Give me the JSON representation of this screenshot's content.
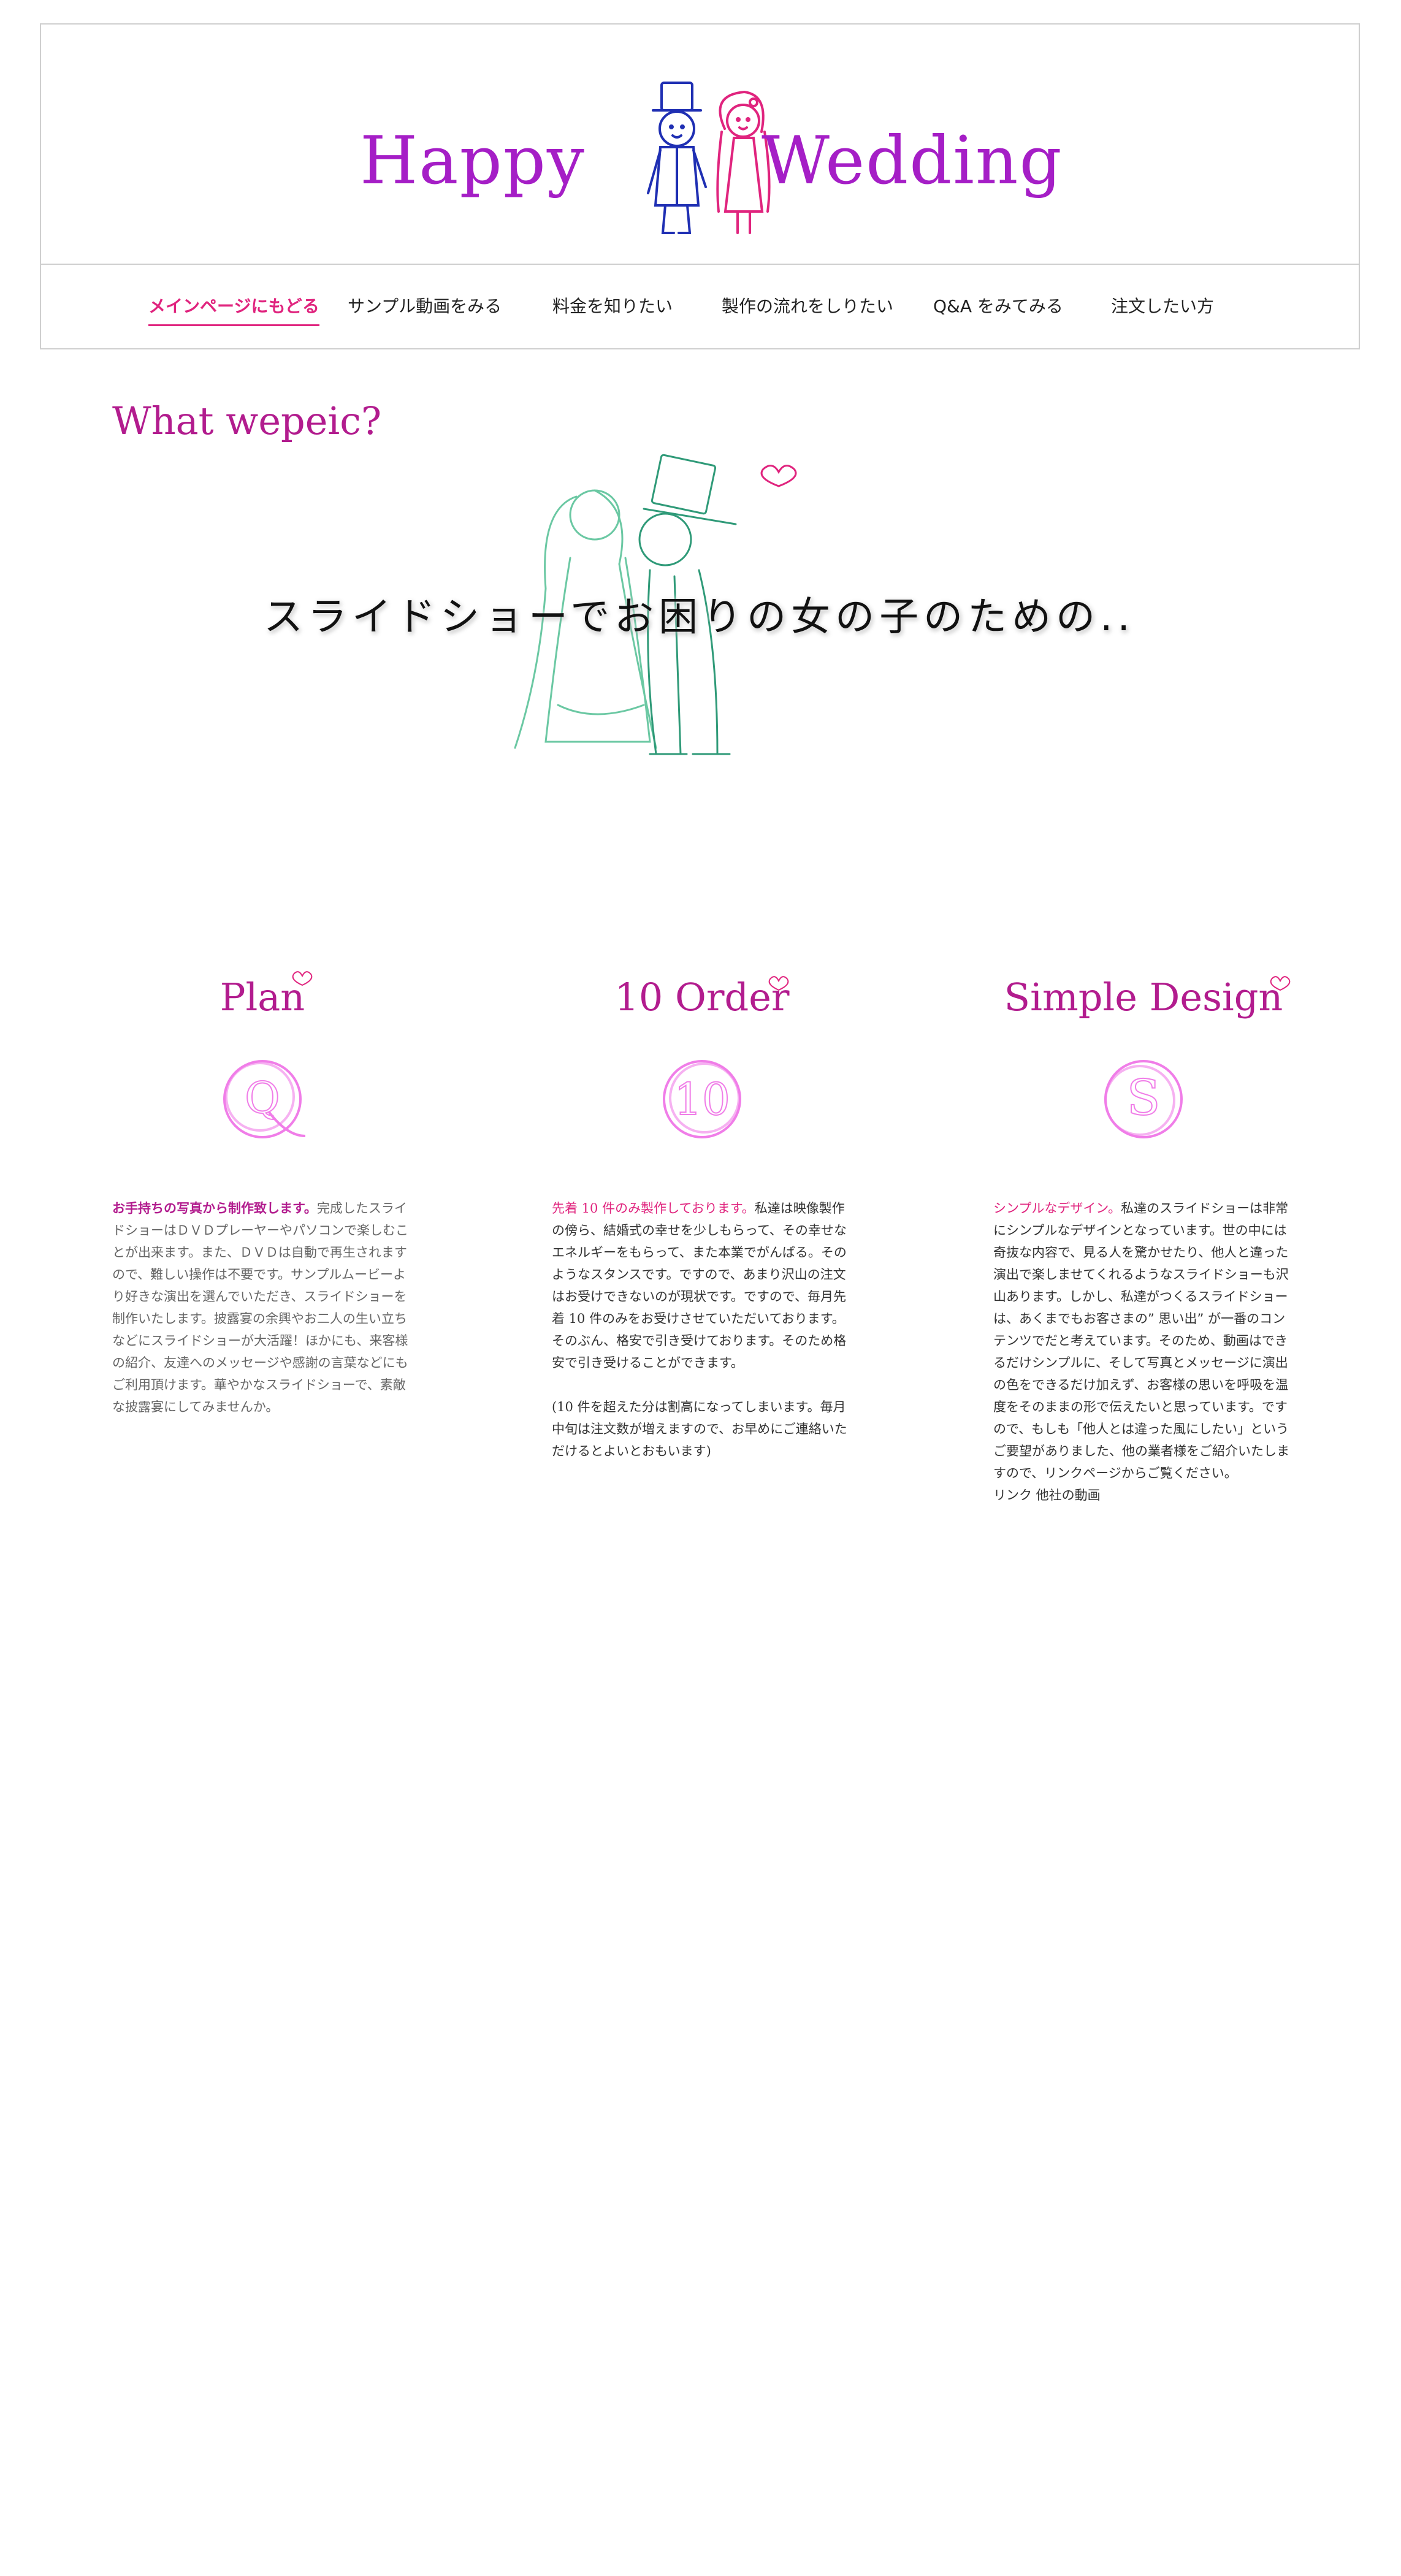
{
  "header": {
    "logo_left": "Happy",
    "logo_right": "Wedding"
  },
  "nav": {
    "items": [
      {
        "label": "メインページにもどる",
        "active": true
      },
      {
        "label": "サンプル動画をみる"
      },
      {
        "label": "料金を知りたい"
      },
      {
        "label": "製作の流れをしりたい"
      },
      {
        "label": "Q&A をみてみる"
      },
      {
        "label": "注文したい方"
      }
    ]
  },
  "hero": {
    "title": "What wepeic?",
    "tagline": "スライドショーでお困りの女の子のための.."
  },
  "features": [
    {
      "title": "Plan",
      "icon_letter": "Q",
      "lead": "お手持ちの写真から制作致します。",
      "body": "完成したスライドショーはＤＶＤプレーヤーやパソコンで楽しむことが出来ます。また、ＤＶＤは自動で再生されますので、難しい操作は不要です。サンプルムービーより好きな演出を選んでいただき、スライドショーを制作いたします。披露宴の余興やお二人の生い立ちなどにスライドショーが大活躍！ほかにも、来客様の紹介、友達へのメッセージや感謝の言葉などにもご利用頂けます。華やかなスライドショーで、素敵な披露宴にしてみませんか。"
    },
    {
      "title": "10 Order",
      "icon_letter": "10",
      "lead": "先着 10 件のみ製作しております。",
      "body": "私達は映像製作の傍ら、結婚式の幸せを少しもらって、その幸せなエネルギーをもらって、また本業でがんばる。そのようなスタンスです。ですので、あまり沢山の注文はお受けできないのが現状です。ですので、毎月先着 10 件のみをお受けさせていただいております。そのぶん、格安で引き受けております。そのため格安で引き受けることができます。",
      "note": "(10 件を超えた分は割高になってしまいます。毎月中旬は注文数が増えますので、お早めにご連絡いただけるとよいとおもいます)"
    },
    {
      "title": "Simple Design",
      "icon_letter": "S",
      "lead": "シンプルなデザイン。",
      "body": "私達のスライドショーは非常にシンプルなデザインとなっています。世の中には奇抜な内容で、見る人を驚かせたり、他人と違った演出で楽しませてくれるようなスライドショーも沢山あります。しかし、私達がつくるスライドショーは、あくまでもお客さまの” 思い出” が一番のコンテンツでだと考えています。そのため、動画はできるだけシンプルに、そして写真とメッセージに演出の色をできるだけ加えず、お客様の思いを呼吸を温度をそのままの形で伝えたいと思っています。ですので、もしも「他人とは違った風にしたい」というご要望がありました、他の業者様をご紹介いたしますので、リンクページからご覧ください。",
      "link": "リンク 他社の動画"
    }
  ],
  "colors": {
    "logo": "#a51ec6",
    "heading": "#b21c8e",
    "accent_pink": "#e0247e",
    "icon_pink": "#f07de8",
    "line_art_green": "#5cc39a"
  }
}
